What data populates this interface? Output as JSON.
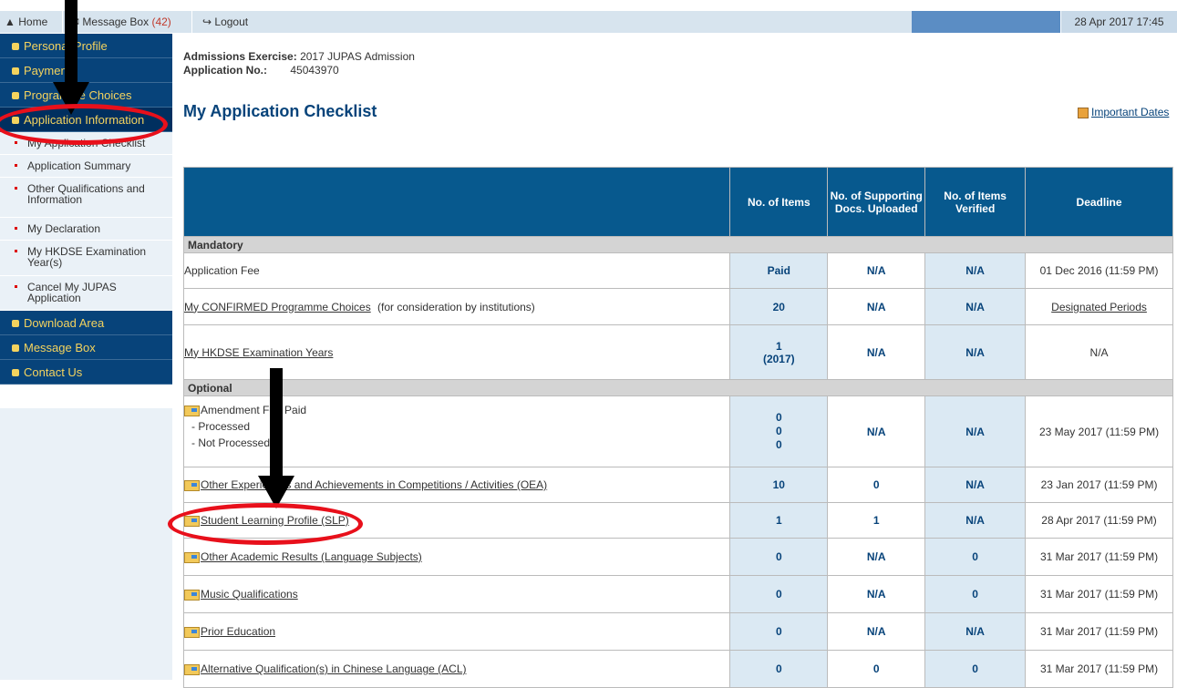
{
  "topnav": {
    "home": "Home",
    "message_box": "Message Box",
    "message_count": "(42)",
    "logout": "Logout",
    "datetime": "28 Apr 2017 17:45"
  },
  "sidebar": {
    "personal_profile": "Personal Profile",
    "payment": "Payment",
    "programme_choices": "Programme Choices",
    "application_information": "Application Information",
    "subitems": [
      "My Application Checklist",
      "Application Summary",
      "Other Qualifications and Information",
      "My Declaration",
      "My HKDSE Examination Year(s)",
      "Cancel My JUPAS Application"
    ],
    "download_area": "Download Area",
    "message_box": "Message Box",
    "contact_us": "Contact Us"
  },
  "info": {
    "exercise_label": "Admissions Exercise:",
    "exercise_value": "2017 JUPAS Admission",
    "appno_label": "Application No.:",
    "appno_value": "45043970"
  },
  "page_title": "My Application Checklist",
  "important_dates": "Important Dates",
  "table": {
    "headers": [
      "No. of Items",
      "No. of Supporting Docs. Uploaded",
      "No. of Items Verified",
      "Deadline"
    ],
    "mandatory_label": "Mandatory",
    "optional_label": "Optional",
    "rows": [
      {
        "desc": "Application Fee",
        "items": "Paid",
        "docs": "N/A",
        "verified": "N/A",
        "deadline": "01 Dec 2016 (11:59 PM)"
      },
      {
        "desc": "My CONFIRMED Programme Choices",
        "note": "(for consideration by institutions)",
        "items": "20",
        "docs": "N/A",
        "verified": "N/A",
        "deadline": "Designated Periods"
      },
      {
        "desc": "My HKDSE Examination Years",
        "items": "1",
        "items2": "(2017)",
        "docs": "N/A",
        "verified": "N/A",
        "deadline": "N/A"
      },
      {
        "desc": "Amendment Fee Paid",
        "sub1": "- Processed",
        "sub2": "- Not Processed",
        "items": "0",
        "items2": "0",
        "items3": "0",
        "docs": "N/A",
        "verified": "N/A",
        "deadline": "23 May 2017 (11:59 PM)"
      },
      {
        "desc": "Other Experiences and Achievements in Competitions / Activities (OEA)",
        "items": "10",
        "docs": "0",
        "verified": "N/A",
        "deadline": "23 Jan 2017 (11:59 PM)"
      },
      {
        "desc": "Student Learning Profile (SLP)",
        "items": "1",
        "docs": "1",
        "verified": "N/A",
        "deadline": "28 Apr 2017 (11:59 PM)"
      },
      {
        "desc": "Other Academic Results (Language Subjects)",
        "items": "0",
        "docs": "N/A",
        "verified": "0",
        "deadline": "31 Mar 2017 (11:59 PM)"
      },
      {
        "desc": "Music Qualifications",
        "items": "0",
        "docs": "N/A",
        "verified": "0",
        "deadline": "31 Mar 2017 (11:59 PM)"
      },
      {
        "desc": "Prior Education",
        "items": "0",
        "docs": "N/A",
        "verified": "N/A",
        "deadline": "31 Mar 2017 (11:59 PM)"
      },
      {
        "desc": "Alternative Qualification(s) in Chinese Language (ACL)",
        "items": "0",
        "docs": "0",
        "verified": "0",
        "deadline": "31 Mar 2017 (11:59 PM)"
      }
    ]
  },
  "colors": {
    "nav_dark": "#07437a",
    "nav_text": "#f4d35e",
    "table_header": "#07598e",
    "annotation_red": "#e8101b"
  }
}
